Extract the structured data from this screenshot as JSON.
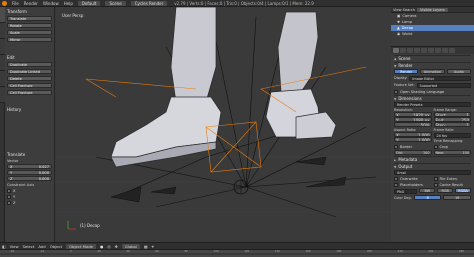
{
  "topbar": {
    "menus": [
      "File",
      "Render",
      "Window",
      "Help"
    ],
    "layout": "Default",
    "scene": "Scene",
    "engine": "Cycles Render",
    "stats": "v2.79 | Verts:0 | Faces:0 | Tris:0 | Objects:0/4 | Lamps:0/1 | Mem: 22.9"
  },
  "toolshelf": {
    "transform_header": "Transform",
    "tools": [
      "Translate",
      "Rotate",
      "Scale",
      "Mirror"
    ],
    "edit_header": "Edit",
    "edit_tools": [
      "Duplicate",
      "Duplicate Linked",
      "Delete",
      "Cell Fracture",
      "Cell Fracture"
    ],
    "history_header": "History",
    "operator_header": "Translate",
    "vector_label": "Vector",
    "vector": [
      {
        "axis": "X",
        "value": "0.027"
      },
      {
        "axis": "Y",
        "value": "0.000"
      },
      {
        "axis": "Z",
        "value": "0.000"
      }
    ],
    "constraint_label": "Constraint Axis",
    "constraint_axes": [
      "X",
      "Y",
      "Z"
    ]
  },
  "viewport": {
    "label": "User Persp",
    "object_label": "(1) Decap"
  },
  "outliner": {
    "header": "View Search",
    "scene_field": "Visible Layers",
    "rows": [
      "Camera",
      "Lamp",
      "Decap",
      "World"
    ]
  },
  "props": {
    "scene_header": "Scene",
    "render_header": "Render",
    "render_buttons": [
      "Render",
      "Animation",
      "Audio"
    ],
    "display_label": "Display:",
    "display_value": "Image Editor",
    "feature_label": "Feature Set:",
    "feature_value": "Supported",
    "osl_label": "Open Shading Language",
    "dimensions_header": "Dimensions",
    "render_presets": "Render Presets",
    "resolution_label": "Resolution:",
    "frame_range_label": "Frame Range:",
    "res_x": "1920 px",
    "res_y": "1080 px",
    "res_pct": "50%",
    "start_frame": "1",
    "end_frame": "250",
    "frame_step": "1",
    "aspect_label": "Aspect Ratio:",
    "frame_rate_label": "Frame Rate:",
    "aspect_x": "1.000",
    "aspect_y": "1.000",
    "frame_rate": "24 fps",
    "time_remap_label": "Time Remapping:",
    "border_label": "Border",
    "crop_label": "Crop",
    "old": "100",
    "new": "100",
    "metadata_header": "Metadata",
    "output_header": "Output",
    "output_path": "/tmp\\",
    "overwrite_label": "Overwrite",
    "file_ext_label": "File Exten.",
    "placeholders_label": "Placeholders",
    "cache_result_label": "Cache Result",
    "format": "PNG",
    "bw": "BW",
    "rgb": "RGB",
    "rgba": "RGBA",
    "color_depth_label": "Color Dep.",
    "color_depth": "8",
    "depth16": "16"
  },
  "vp_header": {
    "menus": [
      "View",
      "Select",
      "Add",
      "Object"
    ],
    "mode": "Object Mode",
    "orientation": "Global"
  },
  "timeline": {
    "frames": [
      "-40",
      "-20",
      "0",
      "20",
      "40",
      "60",
      "80",
      "100",
      "120",
      "140",
      "160",
      "180",
      "200",
      "220",
      "240",
      "260"
    ]
  },
  "colors": {
    "selection": "#e87d0d",
    "active_tab": "#5680c2",
    "background": "#393939"
  }
}
